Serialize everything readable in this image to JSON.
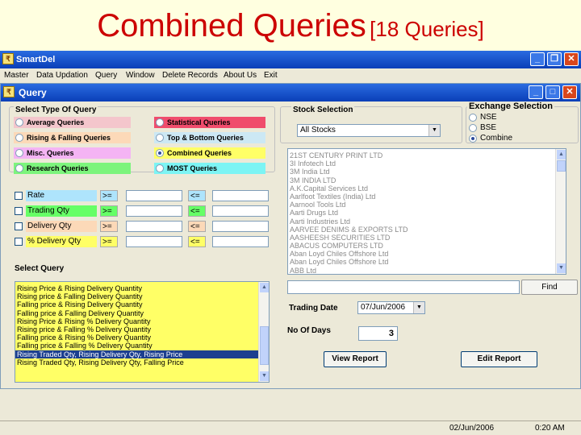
{
  "slide": {
    "title": "Combined Queries",
    "subtitle": "[18 Queries]"
  },
  "app": {
    "title": "SmartDel",
    "menu": [
      "Master",
      "Data Updation",
      "Query",
      "Window",
      "Delete Records",
      "About Us",
      "Exit"
    ]
  },
  "query_window": {
    "title": "Query",
    "select_type_label": "Select Type Of Query",
    "query_types": [
      {
        "label": "Average Queries",
        "color": "#f4c6cc",
        "selected": false
      },
      {
        "label": "Statistical Queries",
        "color": "#f04c6c",
        "selected": false
      },
      {
        "label": "Rising & Falling Queries",
        "color": "#fcd9b8",
        "selected": false
      },
      {
        "label": "Top & Bottom Queries",
        "color": "#cce8f4",
        "selected": false
      },
      {
        "label": "Misc. Queries",
        "color": "#f4b4f4",
        "selected": false
      },
      {
        "label": "Combined Queries",
        "color": "#ffff66",
        "selected": true
      },
      {
        "label": "Research Queries",
        "color": "#7cf47c",
        "selected": false
      },
      {
        "label": "MOST Queries",
        "color": "#7cf4f4",
        "selected": false
      }
    ],
    "criteria": [
      {
        "label": "Rate",
        "color": "#aee4fc",
        "op1": ">=",
        "op2": "<="
      },
      {
        "label": "Trading Qty",
        "color": "#66ff66",
        "op1": ">=",
        "op2": "<="
      },
      {
        "label": "Delivery Qty",
        "color": "#fcd9b8",
        "op1": ">=",
        "op2": "<="
      },
      {
        "label": "% Delivery Qty",
        "color": "#ffff66",
        "op1": ">=",
        "op2": "<="
      }
    ],
    "select_query_label": "Select Query",
    "queries": [
      "Rising Price & Rising Delivery Quantity",
      "Rising price & Falling Delivery Quantity",
      "Falling price & Rising Delivery Quantity",
      "Falling price & Falling Delivery Quantity",
      "Rising Price & Rising % Delivery Quantity",
      "Rising price & Falling % Delivery Quantity",
      "Falling price & Rising % Delivery Quantity",
      "Falling price & Falling % Delivery Quantity",
      "Rising Traded Qty, Rising Delivery Qty, Rising Price",
      "Rising Traded Qty, Rising Delivery Qty, Falling Price"
    ],
    "selected_query_index": 8,
    "stock_selection": {
      "label": "Stock Selection",
      "dropdown_value": "All Stocks",
      "stocks": [
        "21ST CENTURY PRINT LTD",
        "3I Infotech Ltd",
        "3M India Ltd",
        "3M INDIA LTD",
        "A.K.Capital Services Ltd",
        "Aarlfoot Textiles (India) Ltd",
        "Aarnool Tools Ltd",
        "Aarti Drugs Ltd",
        "Aarti Industries Ltd",
        "AARVEE DENIMS & EXPORTS LTD",
        "AASHEESH SECURITIES LTD",
        "ABACUS COMPUTERS LTD",
        "Aban Loyd Chiles Offshore Ltd",
        "Aban Loyd Chiles Offshore Ltd",
        "ABB Ltd"
      ]
    },
    "exchange_selection": {
      "label": "Exchange Selection",
      "options": [
        {
          "label": "NSE",
          "selected": false
        },
        {
          "label": "BSE",
          "selected": false
        },
        {
          "label": "Combine",
          "selected": true
        }
      ]
    },
    "find_label": "Find",
    "trading_date_label": "Trading Date",
    "trading_date_value": "07/Jun/2006",
    "no_of_days_label": "No Of Days",
    "no_of_days_value": "3",
    "view_report_label": "View Report",
    "edit_report_label": "Edit Report"
  },
  "status": {
    "date": "02/Jun/2006",
    "time": "0:20 AM"
  }
}
